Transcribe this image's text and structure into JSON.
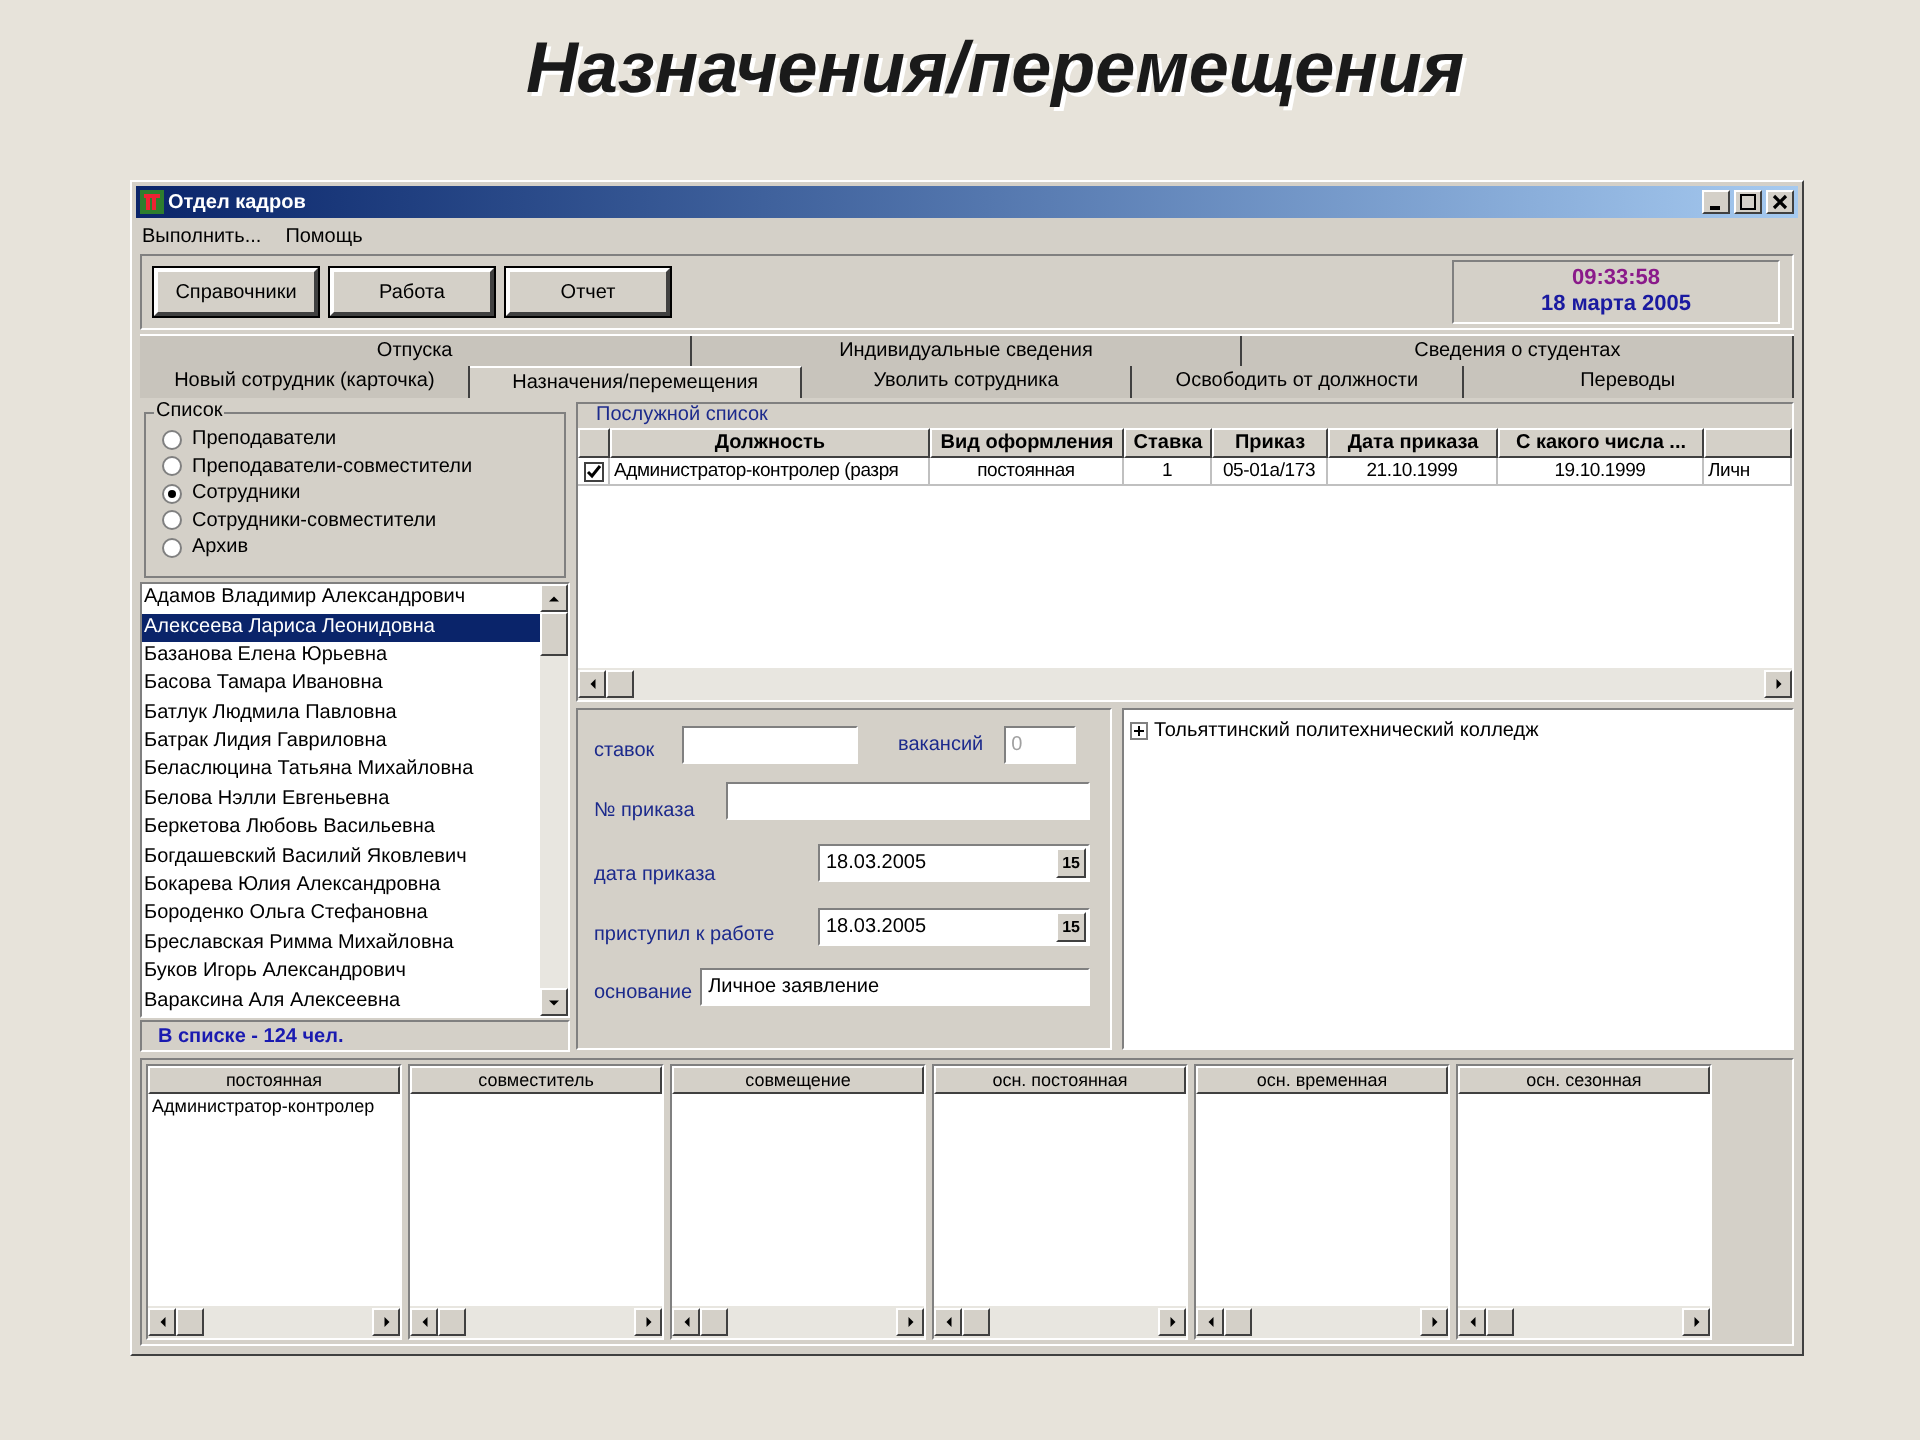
{
  "slide_title": "Назначения/перемещения",
  "window": {
    "title": "Отдел кадров"
  },
  "menu": [
    "Выполнить...",
    "Помощь"
  ],
  "toolbar": [
    "Справочники",
    "Работа",
    "Отчет"
  ],
  "clock": {
    "time": "09:33:58",
    "date": "18 марта 2005"
  },
  "tabs_top": [
    {
      "label": "Отпуска",
      "selected": false
    },
    {
      "label": "Индивидуальные сведения",
      "selected": false
    },
    {
      "label": "Сведения о студентах",
      "selected": false
    }
  ],
  "tabs": [
    {
      "label": "Новый сотрудник (карточка)",
      "selected": false
    },
    {
      "label": "Назначения/перемещения",
      "selected": true
    },
    {
      "label": "Уволить сотрудника",
      "selected": false
    },
    {
      "label": "Освободить от должности",
      "selected": false
    },
    {
      "label": "Переводы",
      "selected": false
    }
  ],
  "list_group": {
    "title": "Список",
    "options": [
      {
        "label": "Преподаватели",
        "selected": false
      },
      {
        "label": "Преподаватели-совместители",
        "selected": false
      },
      {
        "label": "Сотрудники",
        "selected": true
      },
      {
        "label": "Сотрудники-совместители",
        "selected": false
      },
      {
        "label": "Архив",
        "selected": false
      }
    ]
  },
  "people": [
    {
      "name": "Адамов Владимир Александрович",
      "selected": false
    },
    {
      "name": "Алексеева Лариса Леонидовна",
      "selected": true
    },
    {
      "name": "Базанова Елена Юрьевна",
      "selected": false
    },
    {
      "name": "Басова Тамара Ивановна",
      "selected": false
    },
    {
      "name": "Батлук Людмила Павловна",
      "selected": false
    },
    {
      "name": "Батрак Лидия Гавриловна",
      "selected": false
    },
    {
      "name": "Беласлюцина Татьяна Михайловна",
      "selected": false
    },
    {
      "name": "Белова Нэлли Евгеньевна",
      "selected": false
    },
    {
      "name": "Беркетова Любовь Васильевна",
      "selected": false
    },
    {
      "name": "Богдашевский Василий Яковлевич",
      "selected": false
    },
    {
      "name": "Бокарева Юлия Александровна",
      "selected": false
    },
    {
      "name": "Бороденко Ольга Стефановна",
      "selected": false
    },
    {
      "name": "Бреславская Римма Михайловна",
      "selected": false
    },
    {
      "name": "Буков Игорь Александрович",
      "selected": false
    },
    {
      "name": "Вараксина Аля Алексеевна",
      "selected": false
    }
  ],
  "people_count": "В списке - 124 чел.",
  "service_record": {
    "title": "Послужной список",
    "columns": [
      "Должность",
      "Вид оформления",
      "Ставка",
      "Приказ",
      "Дата приказа",
      "С какого числа ..."
    ],
    "rows": [
      {
        "checked": true,
        "cells": [
          "Администратор-контролер (разря",
          "постоянная",
          "1",
          "05-01а/173",
          "21.10.1999",
          "19.10.1999",
          "Личн"
        ]
      }
    ]
  },
  "form": {
    "rates": {
      "label": "ставок"
    },
    "vacancies": {
      "label": "вакансий",
      "value": "0",
      "disabled": true
    },
    "order_no": {
      "label": "№ приказа"
    },
    "order_date": {
      "label": "дата приказа",
      "value": "18.03.2005",
      "button": "15"
    },
    "start_date": {
      "label": "приступил к работе",
      "value": "18.03.2005",
      "button": "15"
    },
    "basis": {
      "label": "основание",
      "value": "Личное заявление"
    }
  },
  "tree": [
    {
      "label": "Тольяттинский политехнический колледж",
      "expanded": false
    }
  ],
  "bottom_lists": [
    {
      "title": "постоянная",
      "items": [
        "Администратор-контролер"
      ]
    },
    {
      "title": "совместитель"
    },
    {
      "title": "совмещение"
    },
    {
      "title": "осн. постоянная"
    },
    {
      "title": "осн. временная"
    },
    {
      "title": "осн. сезонная"
    }
  ]
}
